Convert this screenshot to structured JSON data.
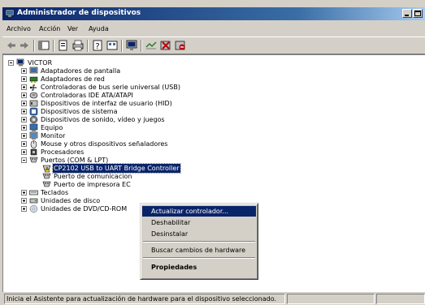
{
  "window": {
    "title": "Administrador de dispositivos",
    "title_icon": "device-manager-icon"
  },
  "menu": [
    "Archivo",
    "Acción",
    "Ver",
    "Ayuda"
  ],
  "toolbar": {
    "icons": [
      "back-icon",
      "forward-icon",
      "show-hide-tree-icon",
      "properties-icon",
      "print-icon",
      "help-icon",
      "view-icon",
      "monitor-icon",
      "scan-hardware-icon",
      "uninstall-icon",
      "disable-icon"
    ]
  },
  "tree": {
    "root": "VICTOR",
    "items": [
      "Adaptadores de pantalla",
      "Adaptadores de red",
      "Controladoras de bus serie universal (USB)",
      "Controladoras IDE ATA/ATAPI",
      "Dispositivos de interfaz de usuario (HID)",
      "Dispositivos de sistema",
      "Dispositivos de sonido, vídeo y juegos",
      "Equipo",
      "Monitor",
      "Mouse y otros dispositivos señaladores",
      "Procesadores",
      "Puertos (COM & LPT)"
    ],
    "ports_children": [
      "CP2102 USB to UART Bridge Controller",
      "Puerto de comunicacion",
      "Puerto de impresora EC"
    ],
    "after_items": [
      "Teclados",
      "Unidades de disco",
      "Unidades de DVD/CD-ROM"
    ]
  },
  "context_menu": {
    "items": [
      "Actualizar controlador...",
      "Deshabilitar",
      "Desinstalar",
      "Buscar cambios de hardware",
      "Propiedades"
    ],
    "highlighted": "Actualizar controlador..."
  },
  "status": {
    "text": "Inicia el Asistente para actualización de hardware para el dispositivo seleccionado."
  },
  "colors": {
    "title": "#0a246a",
    "face": "#d4d0c8",
    "selection": "#0a246a"
  }
}
